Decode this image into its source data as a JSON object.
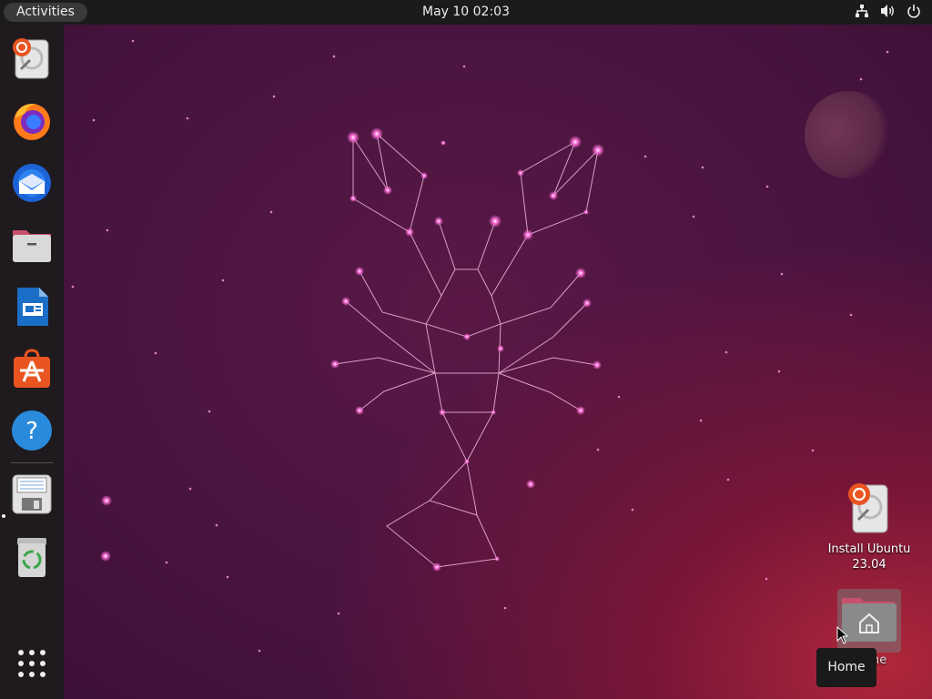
{
  "topbar": {
    "activities_label": "Activities",
    "clock": "May 10  02:03",
    "tray_icons": [
      "network-icon",
      "volume-icon",
      "power-icon"
    ]
  },
  "dock": {
    "apps": [
      {
        "name": "install-ubuntu",
        "icon": "installer-icon"
      },
      {
        "name": "firefox",
        "icon": "firefox-icon"
      },
      {
        "name": "thunderbird",
        "icon": "thunderbird-icon"
      },
      {
        "name": "files",
        "icon": "files-icon"
      },
      {
        "name": "libreoffice-writer",
        "icon": "writer-icon"
      },
      {
        "name": "app-center",
        "icon": "app-center-icon"
      },
      {
        "name": "help",
        "icon": "help-icon"
      },
      {
        "name": "disk-image",
        "icon": "disk-icon"
      },
      {
        "name": "trash",
        "icon": "trash-icon"
      }
    ],
    "show_apps_icon": "app-grid-icon"
  },
  "desktop": {
    "icons": [
      {
        "label": "Install Ubuntu 23.04",
        "icon": "installer-icon"
      },
      {
        "label": "Home",
        "icon": "home-folder-icon"
      }
    ],
    "tooltip": "Home"
  },
  "colors": {
    "topbar": "#1b1b1b",
    "dock": "#1f1a1e",
    "wallpaper": "#4a1440",
    "accent": "#e95420"
  }
}
